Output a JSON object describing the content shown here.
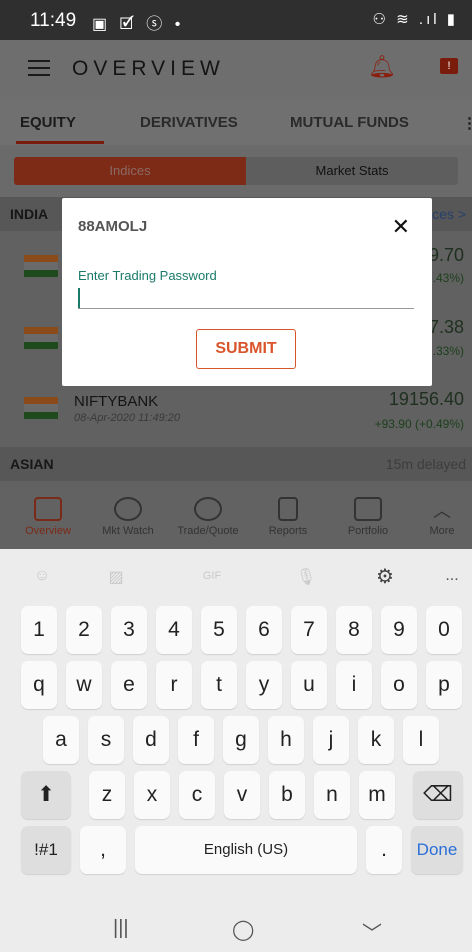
{
  "status_bar": {
    "time": "11:49",
    "left_icons": "▣ 🗹 ⓢ •",
    "right_icons": "⚇ ≋ .ıl ▮"
  },
  "app_bar": {
    "title": "OVERVIEW",
    "alert_badge": "!"
  },
  "tabs": [
    {
      "label": "EQUITY"
    },
    {
      "label": "DERIVATIVES"
    },
    {
      "label": "MUTUAL FUNDS"
    },
    {
      "label": "⋮"
    }
  ],
  "segmented": {
    "indices": "Indices",
    "market_stats": "Market Stats"
  },
  "sections": {
    "india": {
      "label": "INDIA",
      "link": "ices >"
    },
    "asian": {
      "label": "ASIAN",
      "note": "15m delayed"
    }
  },
  "rows": [
    {
      "name": "",
      "date": "",
      "price": "9.70",
      "change": ".43%)"
    },
    {
      "name": "",
      "date": "",
      "price": "7.38",
      "change": ".33%)"
    },
    {
      "name": "NIFTYBANK",
      "date": "08-Apr-2020 11:49:20",
      "price": "19156.40",
      "change": "+93.90 (+0.49%)"
    }
  ],
  "bottom_nav": [
    {
      "label": "Overview"
    },
    {
      "label": "Mkt Watch"
    },
    {
      "label": "Trade/Quote"
    },
    {
      "label": "Reports"
    },
    {
      "label": "Portfolio"
    },
    {
      "label": "More"
    }
  ],
  "dialog": {
    "title": "88AMOLJ",
    "close": "✕",
    "field_label": "Enter Trading Password",
    "field_value": "",
    "submit": "SUBMIT"
  },
  "keyboard": {
    "toolbar": [
      "☺",
      "▨",
      "GIF",
      "🎙",
      "⚙",
      "..."
    ],
    "row_numbers": [
      "1",
      "2",
      "3",
      "4",
      "5",
      "6",
      "7",
      "8",
      "9",
      "0"
    ],
    "row_1": [
      "q",
      "w",
      "e",
      "r",
      "t",
      "y",
      "u",
      "i",
      "o",
      "p"
    ],
    "row_2": [
      "a",
      "s",
      "d",
      "f",
      "g",
      "h",
      "j",
      "k",
      "l"
    ],
    "row_3": [
      "z",
      "x",
      "c",
      "v",
      "b",
      "n",
      "m"
    ],
    "shift": "⬆",
    "backspace": "⌫",
    "symbols": "!#1",
    "comma": ",",
    "space": "English (US)",
    "period": ".",
    "done": "Done"
  },
  "system_nav": {
    "recents": "|||",
    "home": "◯",
    "back": "﹀"
  }
}
